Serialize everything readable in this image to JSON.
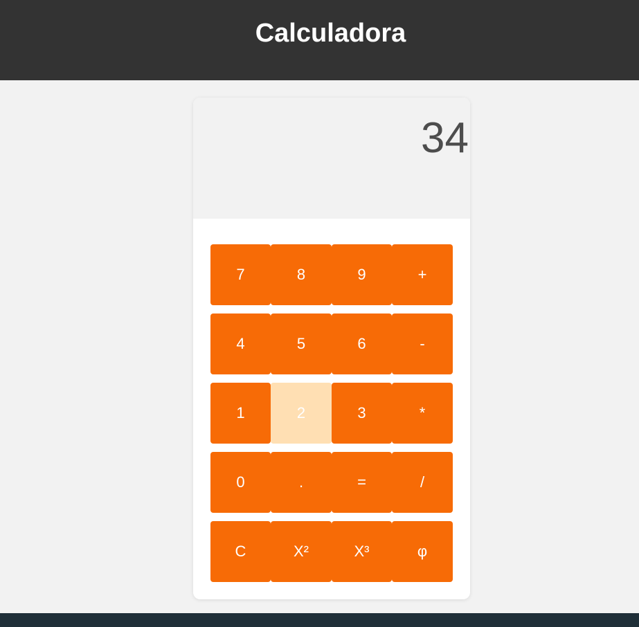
{
  "header": {
    "title": "Calculadora"
  },
  "display": {
    "value": "34"
  },
  "keys": [
    [
      "7",
      "8",
      "9",
      "+"
    ],
    [
      "4",
      "5",
      "6",
      "-"
    ],
    [
      "1",
      "2",
      "3",
      "*"
    ],
    [
      "0",
      ".",
      "=",
      "/"
    ],
    [
      "C",
      "X²",
      "X³",
      "φ"
    ]
  ],
  "active_key": "2",
  "colors": {
    "header_bg": "#333333",
    "page_bg": "#f2f2f2",
    "key_bg": "#f76b06",
    "key_active_bg": "#ffdfb3",
    "display_text": "#4d4d4d",
    "footer_bg": "#1f2f38"
  }
}
